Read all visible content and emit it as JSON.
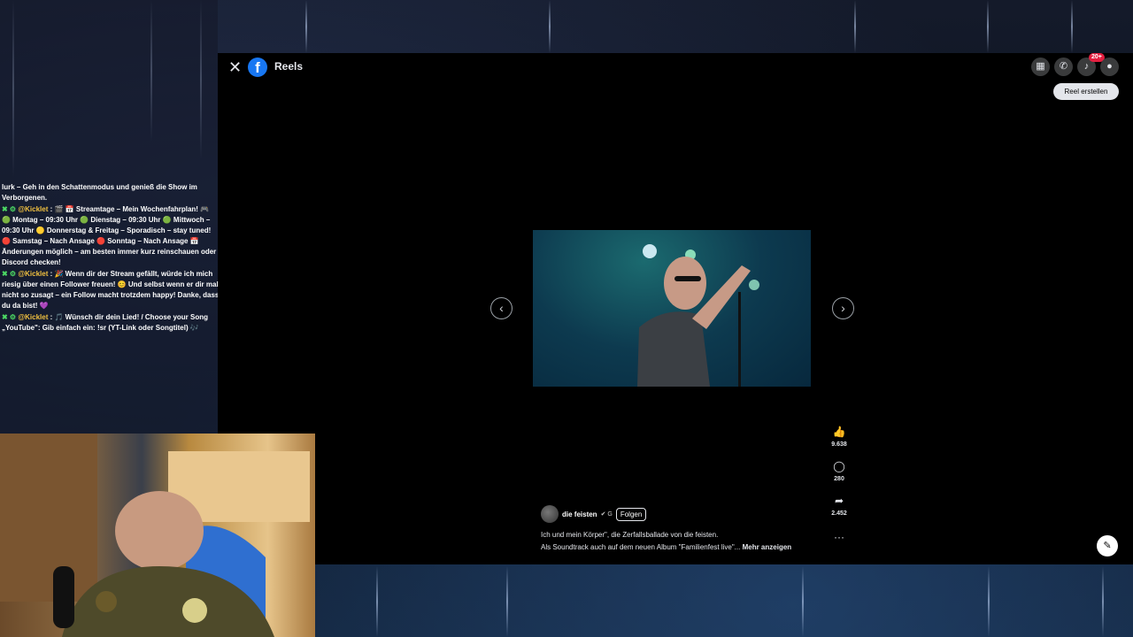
{
  "facebook": {
    "title": "Reels",
    "logo_letter": "f",
    "create_reel_label": "Reel erstellen",
    "notification_badge": "20+",
    "icons": [
      "menu-grid-icon",
      "messenger-icon",
      "bell-icon",
      "profile-icon"
    ]
  },
  "reel": {
    "author": "die feisten",
    "verified_glyph": "✔ G",
    "follow_label": "Folgen",
    "caption_line1": "Ich und mein Körper\", die Zerfallsballade von die feisten.",
    "caption_line2": "Als Soundtrack auch auf dem neuen Album \"Familienfest live\"...",
    "more_label": "Mehr anzeigen",
    "likes": "9.638",
    "comments": "280",
    "shares": "2.452",
    "more_options": "···"
  },
  "chat": {
    "messages": [
      {
        "user": "",
        "text": "lurk – Geh in den Schattenmodus und genieß die Show im Verborgenen."
      },
      {
        "user": "@Kicklet",
        "text": ": 🎬 📅 Streamtage – Mein Wochenfahrplan! 🎮 🟢 Montag – 09:30 Uhr 🟢 Dienstag – 09:30 Uhr 🟢 Mittwoch – 09:30 Uhr 🟡 Donnerstag & Freitag – Sporadisch – stay tuned! 🔴 Samstag – Nach Ansage 🔴 Sonntag – Nach Ansage 📅 Änderungen möglich – am besten immer kurz reinschauen oder Discord checken!"
      },
      {
        "user": "@Kicklet",
        "text": ": 🎉 Wenn dir der Stream gefällt, würde ich mich riesig über einen Follower freuen! 😊 Und selbst wenn er dir mal nicht so zusagt – ein Follow macht trotzdem happy! Danke, dass du da bist! 💜"
      },
      {
        "user": "@Kicklet",
        "text": ": 🎵 Wünsch dir dein Lied! / Choose your Song „YouTube\": Gib einfach ein: !sr (YT-Link oder Songtitel) 🎶"
      }
    ]
  }
}
